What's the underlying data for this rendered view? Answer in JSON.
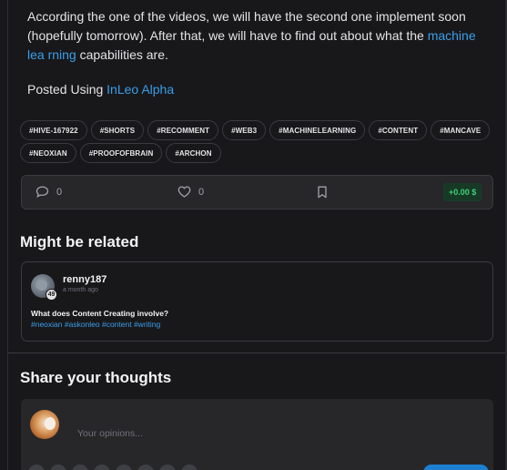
{
  "post": {
    "paragraph1_text": "According the one of the videos, we will have the second one implement soon (hopefully tomorrow). After that, we will have to find out about what the ",
    "paragraph1_link": "machine lea rning",
    "paragraph1_tail": " capabilities are.",
    "posted_using_prefix": "Posted Using ",
    "posted_using_link": "InLeo Alpha"
  },
  "tags": [
    "#HIVE-167922",
    "#SHORTS",
    "#RECOMMENT",
    "#WEB3",
    "#MACHINELEARNING",
    "#CONTENT",
    "#MANCAVE",
    "#NEOXIAN",
    "#PROOFOFBRAIN",
    "#ARCHON"
  ],
  "actions": {
    "comments_count": "0",
    "votes_count": "0",
    "payout": "+0.00 $"
  },
  "related": {
    "heading": "Might be related",
    "author": "renny187",
    "reputation": "49",
    "time": "a month ago",
    "title": "What does Content Creating involve?",
    "tags_text": "#neoxian #askonleo #content #writing"
  },
  "share": {
    "heading": "Share your thoughts",
    "placeholder": "Your opinions..."
  },
  "icons": [
    "comment-icon",
    "heart-icon",
    "bookmark-icon"
  ],
  "colors": {
    "accent": "#3b9ee8",
    "payout": "#3fd07a",
    "background": "#18181b",
    "card": "#27272a"
  }
}
